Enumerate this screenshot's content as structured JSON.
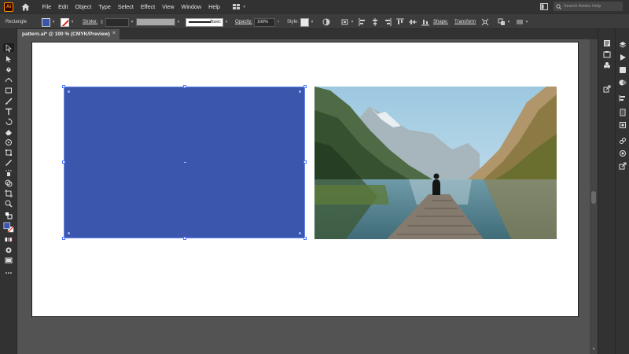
{
  "menubar": {
    "app_logo": "Ai",
    "items": [
      "File",
      "Edit",
      "Object",
      "Type",
      "Select",
      "Effect",
      "View",
      "Window",
      "Help"
    ],
    "search_placeholder": "Search Adobe Help"
  },
  "controlbar": {
    "tool_name": "Rectangle",
    "stroke_label": "Stroke:",
    "brush_value": "Basic",
    "opacity_label": "Opacity:",
    "opacity_value": "100%",
    "style_label": "Style:",
    "shape_label": "Shape:",
    "transform_label": "Transform",
    "fill_color": "#3a56ad"
  },
  "document": {
    "tab_title": "pattern.ai* @ 100 % (CMYK/Preview)",
    "close_glyph": "×"
  },
  "artwork": {
    "rectangle_color": "#3a56ad",
    "photo_subject": "person sitting on wooden pier at mountain lake"
  },
  "icons": {
    "home": "home-icon",
    "search": "search-icon",
    "more": "more-tools-icon"
  }
}
